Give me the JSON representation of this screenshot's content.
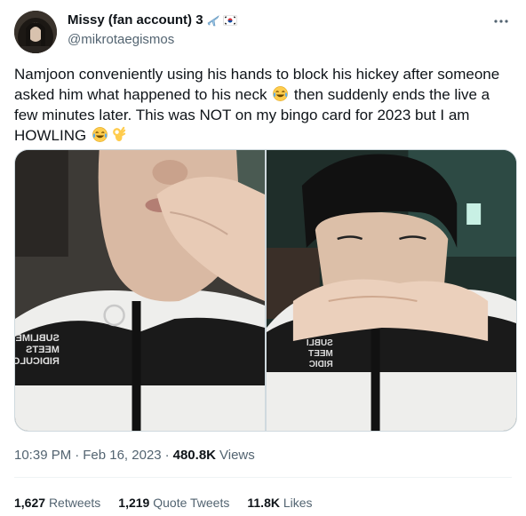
{
  "author": {
    "display_name": "Missy (fan account) 3",
    "handle": "@mikrotaegismos",
    "name_emojis": [
      "airplane-emoji",
      "south-korea-flag-emoji"
    ]
  },
  "tweet": {
    "text_1": "Namjoon conveniently using his hands to block his hickey after someone asked him what happened to his neck ",
    "text_2": " then suddenly ends the live a few minutes later. This was NOT on my bingo card for 2023 but I am HOWLING ",
    "inline_emojis": [
      "tears-of-joy-emoji",
      "tears-of-joy-emoji",
      "ok-hand-emoji"
    ]
  },
  "media": {
    "photos": [
      {
        "jacket_text": [
          "SUBLIME",
          "MEETS",
          "RIDICULOUS"
        ]
      },
      {
        "jacket_text": [
          "SUBLI",
          "MEET",
          "RIDIC"
        ]
      }
    ]
  },
  "meta": {
    "time": "10:39 PM",
    "sep1": "·",
    "date": "Feb 16, 2023",
    "sep2": "·",
    "views": "480.8K",
    "views_label": "Views"
  },
  "stats": {
    "retweets": "1,627",
    "retweets_label": "Retweets",
    "quotes": "1,219",
    "quotes_label": "Quote Tweets",
    "likes": "11.8K",
    "likes_label": "Likes"
  },
  "colors": {
    "text_primary": "#0f1419",
    "text_secondary": "#536471",
    "border": "#cfd9de",
    "divider": "#eff3f4"
  }
}
